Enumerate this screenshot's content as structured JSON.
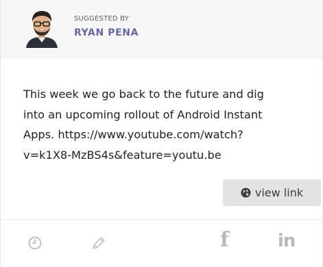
{
  "header": {
    "label": "SUGGESTED BY",
    "author": "RYAN PENA"
  },
  "post": {
    "lines": [
      "This week we go back to the future and dig",
      "into an upcoming rollout of Android Instant",
      "Apps. https://www.youtube.com/watch?",
      "v=k1X8-MzBS4s&feature=youtu.be"
    ]
  },
  "actions": {
    "view_link_label": "view link",
    "view_link_icon": "globe-icon",
    "facebook_glyph": "f",
    "linkedin_glyph": "in"
  },
  "colors": {
    "author": "#646aa0",
    "icon_gray": "#b9b9b9",
    "button_bg": "#e3e3e3"
  }
}
